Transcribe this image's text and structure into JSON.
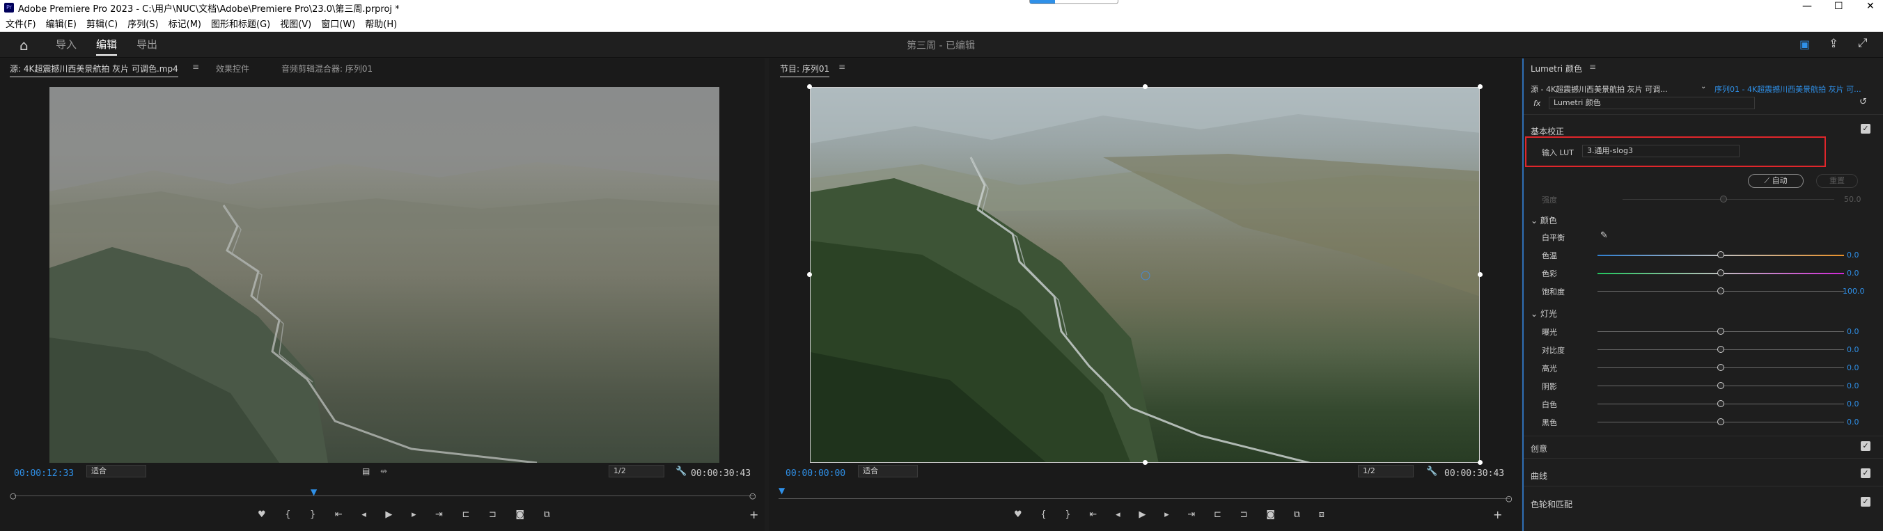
{
  "titlebar": {
    "app_icon": "Pr",
    "title": "Adobe Premiere Pro 2023 - C:\\用户\\NUC\\文档\\Adobe\\Premiere Pro\\23.0\\第三周.prproj *"
  },
  "menu": [
    "文件(F)",
    "编辑(E)",
    "剪辑(C)",
    "序列(S)",
    "标记(M)",
    "图形和标题(G)",
    "视图(V)",
    "窗口(W)",
    "帮助(H)"
  ],
  "header": {
    "tabs": [
      "导入",
      "编辑",
      "导出"
    ],
    "active_tab": "编辑",
    "project_title": "第三周 - 已编辑"
  },
  "source_panel": {
    "tabs": [
      "源: 4K超震撼川西美景航拍 灰片 可调色.mp4",
      "效果控件",
      "音频剪辑混合器: 序列01"
    ],
    "timecode": "00:00:12:33",
    "fit": "适合",
    "resolution": "1/2",
    "duration": "00:00:30:43"
  },
  "program_panel": {
    "tab": "节目: 序列01",
    "timecode": "00:00:00:00",
    "fit": "适合",
    "resolution": "1/2",
    "duration": "00:00:30:43"
  },
  "lumetri": {
    "panel_title": "Lumetri 颜色",
    "source_clip": "源 - 4K超震撼川西美景航拍 灰片 可调...",
    "sequence_clip": "序列01 - 4K超震撼川西美景航拍 灰片 可...",
    "fx_label": "fx",
    "fx_select": "Lumetri 颜色",
    "basic_correction": "基本校正",
    "input_lut_label": "输入 LUT",
    "input_lut_value": "3.通用-slog3",
    "auto_button": "自动",
    "reset_button": "重置",
    "intensity_label": "强度",
    "intensity_value": "50.0",
    "color_section": "颜色",
    "white_balance": "白平衡",
    "color_rows": [
      {
        "label": "色温",
        "value": "0.0"
      },
      {
        "label": "色彩",
        "value": "0.0"
      },
      {
        "label": "饱和度",
        "value": "100.0"
      }
    ],
    "light_section": "灯光",
    "light_rows": [
      {
        "label": "曝光",
        "value": "0.0"
      },
      {
        "label": "对比度",
        "value": "0.0"
      },
      {
        "label": "高光",
        "value": "0.0"
      },
      {
        "label": "阴影",
        "value": "0.0"
      },
      {
        "label": "白色",
        "value": "0.0"
      },
      {
        "label": "黑色",
        "value": "0.0"
      }
    ],
    "sections": [
      "创意",
      "曲线",
      "色轮和匹配"
    ]
  },
  "colors": {
    "accent": "#2f90e8",
    "highlight_box": "#e0262b"
  }
}
